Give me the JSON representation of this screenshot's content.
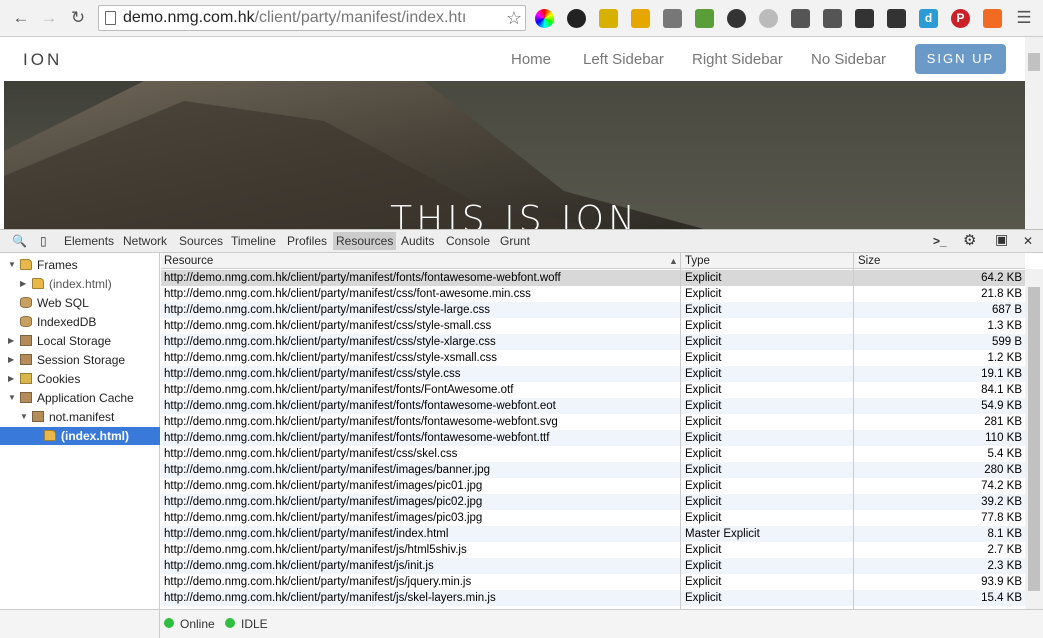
{
  "browser": {
    "url_domain": "demo.nmg.com.hk",
    "url_path": "/client/party/manifest/index.htı"
  },
  "site": {
    "logo": "ION",
    "nav": [
      "Home",
      "Left Sidebar",
      "Right Sidebar",
      "No Sidebar"
    ],
    "signup": "SIGN UP",
    "banner_title": "THIS IS ION"
  },
  "devtools": {
    "tabs": [
      "Elements",
      "Network",
      "Sources",
      "Timeline",
      "Profiles",
      "Resources",
      "Audits",
      "Console",
      "Grunt"
    ],
    "active_tab": "Resources",
    "tree": [
      {
        "label": "Frames",
        "level": 0,
        "arrow": "down",
        "icon": "folder-icon"
      },
      {
        "label": "(index.html)",
        "level": 1,
        "arrow": "right",
        "icon": "folder-icon"
      },
      {
        "label": "Web SQL",
        "level": 0,
        "arrow": "",
        "icon": "database-icon"
      },
      {
        "label": "IndexedDB",
        "level": 0,
        "arrow": "",
        "icon": "database-icon"
      },
      {
        "label": "Local Storage",
        "level": 0,
        "arrow": "right",
        "icon": "grid-icon"
      },
      {
        "label": "Session Storage",
        "level": 0,
        "arrow": "right",
        "icon": "grid-icon"
      },
      {
        "label": "Cookies",
        "level": 0,
        "arrow": "right",
        "icon": "cookie-icon"
      },
      {
        "label": "Application Cache",
        "level": 0,
        "arrow": "down",
        "icon": "grid-icon"
      },
      {
        "label": "not.manifest",
        "level": 1,
        "arrow": "down",
        "icon": "grid-icon"
      },
      {
        "label": "(index.html)",
        "level": 2,
        "arrow": "",
        "icon": "folder-icon",
        "selected": true
      }
    ],
    "columns": [
      "Resource",
      "Type",
      "Size"
    ],
    "rows": [
      {
        "resource": "http://demo.nmg.com.hk/client/party/manifest/fonts/fontawesome-webfont.woff",
        "type": "Explicit",
        "size": "64.2 KB"
      },
      {
        "resource": "http://demo.nmg.com.hk/client/party/manifest/css/font-awesome.min.css",
        "type": "Explicit",
        "size": "21.8 KB"
      },
      {
        "resource": "http://demo.nmg.com.hk/client/party/manifest/css/style-large.css",
        "type": "Explicit",
        "size": "687 B"
      },
      {
        "resource": "http://demo.nmg.com.hk/client/party/manifest/css/style-small.css",
        "type": "Explicit",
        "size": "1.3 KB"
      },
      {
        "resource": "http://demo.nmg.com.hk/client/party/manifest/css/style-xlarge.css",
        "type": "Explicit",
        "size": "599 B"
      },
      {
        "resource": "http://demo.nmg.com.hk/client/party/manifest/css/style-xsmall.css",
        "type": "Explicit",
        "size": "1.2 KB"
      },
      {
        "resource": "http://demo.nmg.com.hk/client/party/manifest/css/style.css",
        "type": "Explicit",
        "size": "19.1 KB"
      },
      {
        "resource": "http://demo.nmg.com.hk/client/party/manifest/fonts/FontAwesome.otf",
        "type": "Explicit",
        "size": "84.1 KB"
      },
      {
        "resource": "http://demo.nmg.com.hk/client/party/manifest/fonts/fontawesome-webfont.eot",
        "type": "Explicit",
        "size": "54.9 KB"
      },
      {
        "resource": "http://demo.nmg.com.hk/client/party/manifest/fonts/fontawesome-webfont.svg",
        "type": "Explicit",
        "size": "281 KB"
      },
      {
        "resource": "http://demo.nmg.com.hk/client/party/manifest/fonts/fontawesome-webfont.ttf",
        "type": "Explicit",
        "size": "110 KB"
      },
      {
        "resource": "http://demo.nmg.com.hk/client/party/manifest/css/skel.css",
        "type": "Explicit",
        "size": "5.4 KB"
      },
      {
        "resource": "http://demo.nmg.com.hk/client/party/manifest/images/banner.jpg",
        "type": "Explicit",
        "size": "280 KB"
      },
      {
        "resource": "http://demo.nmg.com.hk/client/party/manifest/images/pic01.jpg",
        "type": "Explicit",
        "size": "74.2 KB"
      },
      {
        "resource": "http://demo.nmg.com.hk/client/party/manifest/images/pic02.jpg",
        "type": "Explicit",
        "size": "39.2 KB"
      },
      {
        "resource": "http://demo.nmg.com.hk/client/party/manifest/images/pic03.jpg",
        "type": "Explicit",
        "size": "77.8 KB"
      },
      {
        "resource": "http://demo.nmg.com.hk/client/party/manifest/index.html",
        "type": "Master Explicit",
        "size": "8.1 KB"
      },
      {
        "resource": "http://demo.nmg.com.hk/client/party/manifest/js/html5shiv.js",
        "type": "Explicit",
        "size": "2.7 KB"
      },
      {
        "resource": "http://demo.nmg.com.hk/client/party/manifest/js/init.js",
        "type": "Explicit",
        "size": "2.3 KB"
      },
      {
        "resource": "http://demo.nmg.com.hk/client/party/manifest/js/jquery.min.js",
        "type": "Explicit",
        "size": "93.9 KB"
      },
      {
        "resource": "http://demo.nmg.com.hk/client/party/manifest/js/skel-layers.min.js",
        "type": "Explicit",
        "size": "15.4 KB"
      }
    ],
    "status": {
      "connection": "Online",
      "cache_status": "IDLE"
    }
  }
}
